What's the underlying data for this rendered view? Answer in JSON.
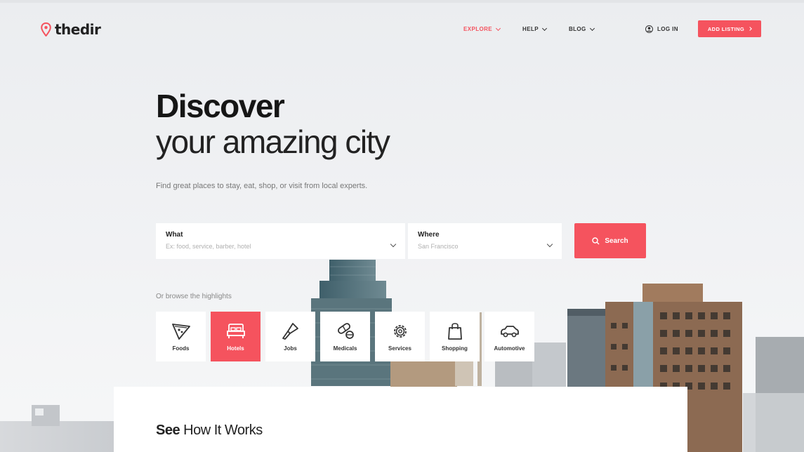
{
  "brand": {
    "name": "thedir",
    "accent": "#f5535e"
  },
  "nav": {
    "items": [
      {
        "label": "EXPLORE",
        "active": true
      },
      {
        "label": "HELP",
        "active": false
      },
      {
        "label": "BLOG",
        "active": false
      }
    ],
    "login_label": "LOG IN",
    "add_listing_label": "ADD LISTING"
  },
  "hero": {
    "title_bold": "Discover",
    "title_light": "your amazing city",
    "subtitle": "Find great places to stay, eat, shop, or visit from local experts."
  },
  "search": {
    "what_label": "What",
    "what_placeholder": "Ex: food, service, barber, hotel",
    "where_label": "Where",
    "where_placeholder": "San Francisco",
    "button_label": "Search"
  },
  "browse": {
    "label": "Or browse the highlights",
    "categories": [
      {
        "label": "Foods",
        "icon": "pizza-icon",
        "active": false
      },
      {
        "label": "Hotels",
        "icon": "bed-icon",
        "active": true
      },
      {
        "label": "Jobs",
        "icon": "brush-icon",
        "active": false
      },
      {
        "label": "Medicals",
        "icon": "pills-icon",
        "active": false
      },
      {
        "label": "Services",
        "icon": "gear-icon",
        "active": false
      },
      {
        "label": "Shopping",
        "icon": "shopping-bag-icon",
        "active": false
      },
      {
        "label": "Automotive",
        "icon": "car-icon",
        "active": false
      }
    ]
  },
  "how": {
    "bold": "See",
    "rest": "How It Works"
  }
}
